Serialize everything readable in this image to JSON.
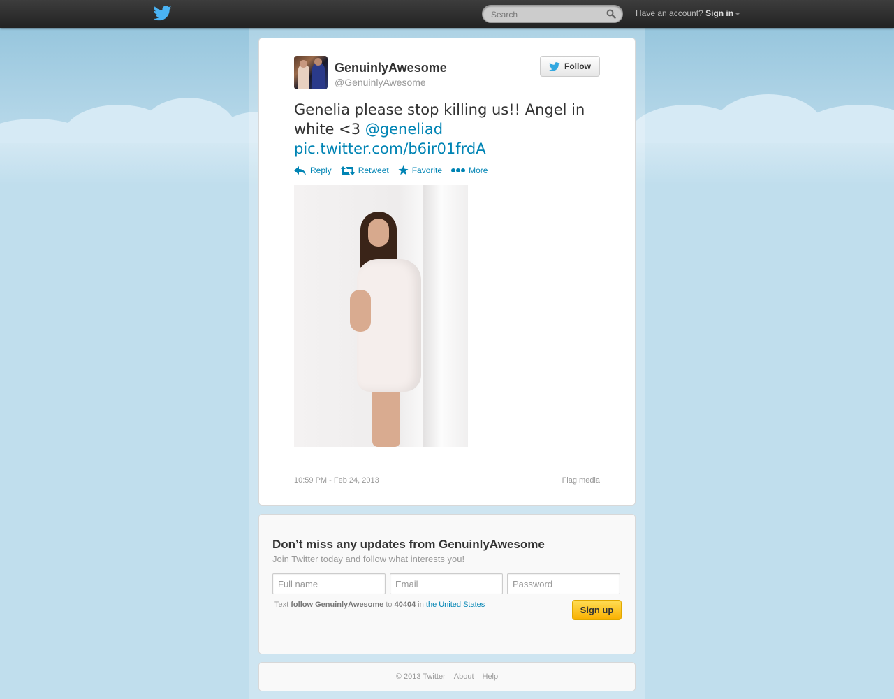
{
  "topbar": {
    "search_placeholder": "Search",
    "account_prompt": "Have an account?",
    "sign_in_label": "Sign in"
  },
  "tweet": {
    "full_name": "GenuinlyAwesome",
    "screen_name": "@GenuinlyAwesome",
    "follow_label": "Follow",
    "text_plain": "Genelia please stop killing us!! Angel in white <3 ",
    "mention": "@geneliad",
    "link": "pic.twitter.com/b6ir01frdA",
    "actions": {
      "reply": "Reply",
      "retweet": "Retweet",
      "favorite": "Favorite",
      "more": "More"
    },
    "timestamp": "10:59 PM - Feb 24, 2013",
    "flag_media": "Flag media"
  },
  "signup": {
    "title": "Don’t miss any updates from GenuinlyAwesome",
    "subtitle": "Join Twitter today and follow what interests you!",
    "fullname_placeholder": "Full name",
    "email_placeholder": "Email",
    "password_placeholder": "Password",
    "sms_text_prefix": "Text",
    "sms_command": "follow GenuinlyAwesome",
    "sms_to": "to",
    "sms_number": "40404",
    "sms_in": "in",
    "sms_country": "the United States",
    "signup_label": "Sign up"
  },
  "footer": {
    "copyright": "© 2013 Twitter",
    "about": "About",
    "help": "Help"
  },
  "colors": {
    "link": "#0084b4",
    "topbar": "#2b2b2b",
    "background": "#c0deed",
    "signup_button": "#f9b000"
  },
  "icons": {
    "logo": "twitter-bird-icon",
    "search": "magnifier-icon",
    "reply": "reply-arrow-icon",
    "retweet": "retweet-icon",
    "favorite": "star-icon",
    "more": "ellipsis-icon"
  }
}
